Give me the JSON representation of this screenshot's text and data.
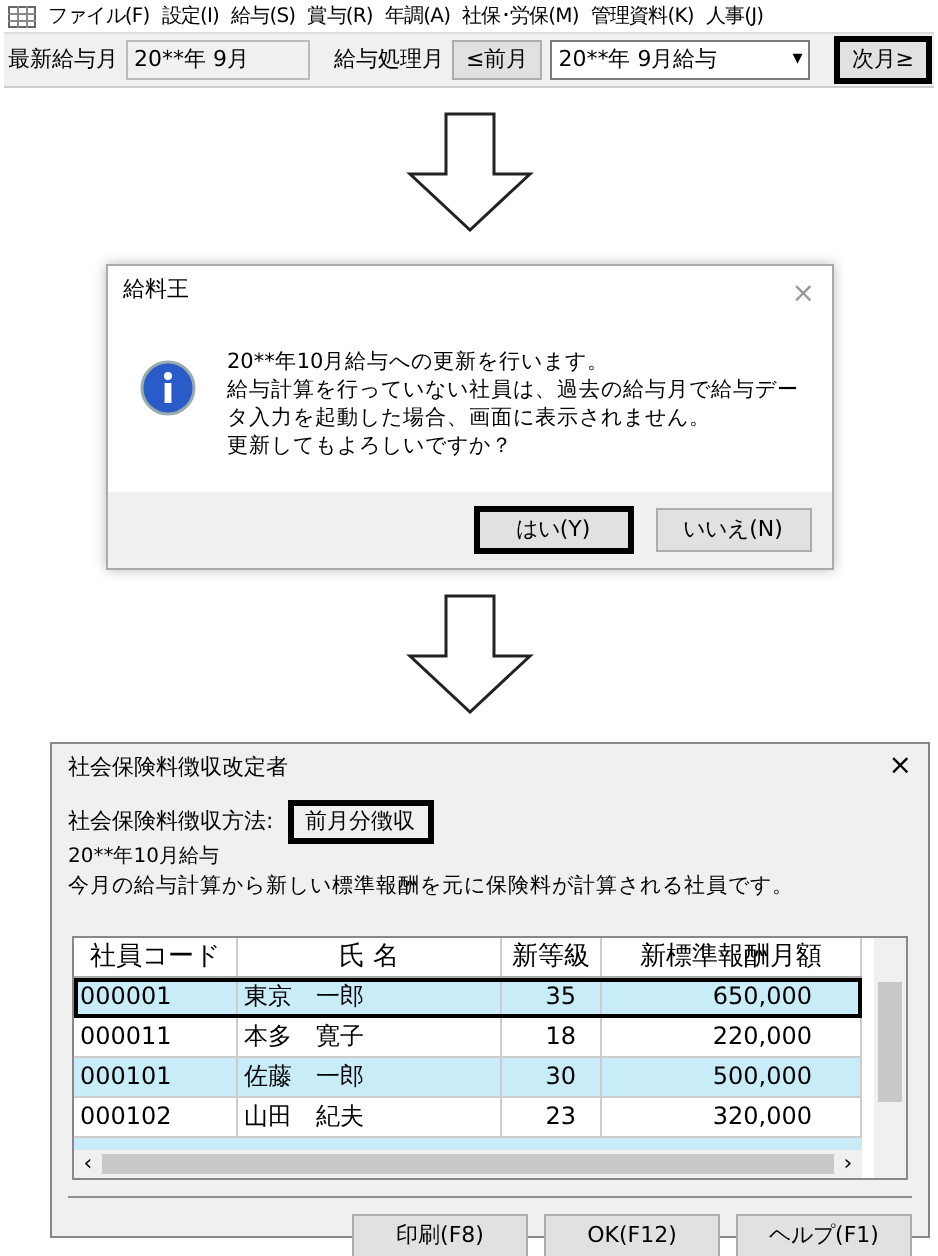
{
  "menu": [
    {
      "label": "ファイル(F)"
    },
    {
      "label": "設定(I)"
    },
    {
      "label": "給与(S)"
    },
    {
      "label": "賞与(R)"
    },
    {
      "label": "年調(A)"
    },
    {
      "label": "社保･労保(M)"
    },
    {
      "label": "管理資料(K)"
    },
    {
      "label": "人事(J)"
    }
  ],
  "toolbar": {
    "latest_label": "最新給与月",
    "latest_value": "20**年 9月",
    "process_label": "給与処理月",
    "prev_button": {
      "label": "≤前月",
      "highlighted": false
    },
    "month_select": "20**年 9月給与",
    "dropdown_arrow": "▾",
    "next_button": {
      "label": "次月≥",
      "highlighted": true
    }
  },
  "dialog": {
    "title": "給料王",
    "close": "×",
    "message": [
      "20**年10月給与への更新を行います。",
      "給与計算を行っていない社員は、過去の給与月で給与データ入力を起動した場合、画面に表示されません。",
      "更新してもよろしいですか？"
    ],
    "buttons": [
      {
        "label": "はい(Y)",
        "highlighted": true
      },
      {
        "label": "いいえ(N)",
        "highlighted": false
      }
    ]
  },
  "window": {
    "title": "社会保険料徴収改定者",
    "close": "×",
    "method_label": "社会保険料徴収方法:",
    "method_value": "前月分徴収",
    "method_highlighted": true,
    "month": "20**年10月給与",
    "description": "今月の給与計算から新しい標準報酬を元に保険料が計算される社員です。",
    "table": {
      "columns": [
        "社員コード",
        "氏 名",
        "新等級",
        "新標準報酬月額"
      ],
      "rows": [
        {
          "cells": [
            "000001",
            "東京　一郎",
            "35",
            "650,000"
          ],
          "shaded": true,
          "highlighted": true
        },
        {
          "cells": [
            "000011",
            "本多　寛子",
            "18",
            "220,000"
          ],
          "shaded": false,
          "highlighted": false
        },
        {
          "cells": [
            "000101",
            "佐藤　一郎",
            "30",
            "500,000"
          ],
          "shaded": true,
          "highlighted": false
        },
        {
          "cells": [
            "000102",
            "山田　紀夫",
            "23",
            "320,000"
          ],
          "shaded": false,
          "highlighted": false
        }
      ]
    },
    "scroll_left": "‹",
    "scroll_right": "›",
    "buttons": [
      {
        "label": "印刷(F8)"
      },
      {
        "label": "OK(F12)"
      },
      {
        "label": "ヘルプ(F1)"
      }
    ]
  }
}
